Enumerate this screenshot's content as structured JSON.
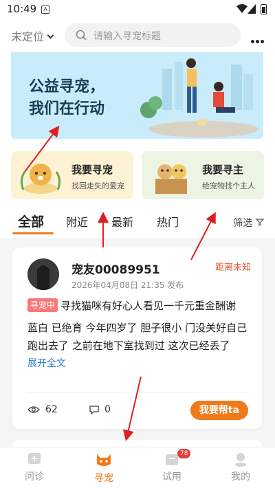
{
  "status": {
    "time": "10:49",
    "notif": "A"
  },
  "header": {
    "location": "未定位",
    "search_placeholder": "请输入寻宠标题"
  },
  "banner": {
    "line1": "公益寻宠，",
    "line2": "我们在行动"
  },
  "cards": [
    {
      "title": "我要寻宠",
      "subtitle": "找回走失的爱宠"
    },
    {
      "title": "我要寻主",
      "subtitle": "给宠物找个主人"
    }
  ],
  "tabs": [
    "全部",
    "附近",
    "最新",
    "热门"
  ],
  "filter": "筛选",
  "post": {
    "user": "宠友00089951",
    "time": "2026年04月08日 21:35 发布",
    "distance": "距离未知",
    "badge": "寻宠中",
    "title": "寻找猫咪有好心人看见一千元重金酬谢",
    "body": "蓝白 已绝育 今年四岁了 胆子很小 门没关好自己跑出去了 之前在地下室找到过 这次已经丢了十...",
    "expand": "展开全文",
    "views": "62",
    "comments": "0",
    "help": "我要帮ta"
  },
  "nav": [
    {
      "label": "问诊"
    },
    {
      "label": "寻宠"
    },
    {
      "label": "试用",
      "badge": "78"
    },
    {
      "label": "我的"
    }
  ],
  "colors": {
    "accent": "#f07a1a",
    "distance": "#f0542d",
    "badge": "#f97878",
    "link": "#2d7bd6"
  }
}
